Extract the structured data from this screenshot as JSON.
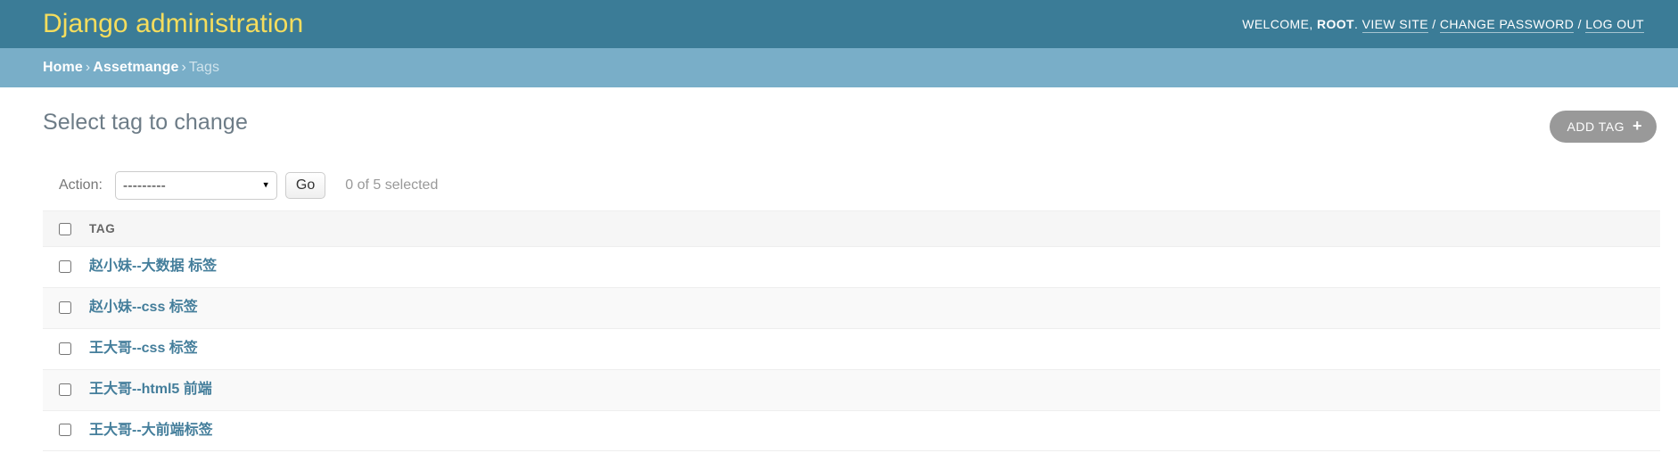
{
  "header": {
    "site_title": "Django administration",
    "welcome_prefix": "WELCOME,",
    "username": "ROOT",
    "welcome_suffix": ".",
    "links": {
      "view_site": "VIEW SITE",
      "change_password": "CHANGE PASSWORD",
      "log_out": "LOG OUT"
    },
    "separator": "/"
  },
  "breadcrumbs": {
    "home": "Home",
    "app": "Assetmange",
    "current": "Tags",
    "separator": "›"
  },
  "content": {
    "page_title": "Select tag to change",
    "add_button": {
      "label": "ADD TAG",
      "icon": "plus-icon",
      "icon_glyph": "+"
    }
  },
  "actions_bar": {
    "label": "Action:",
    "select_value": "---------",
    "select_options": [
      "---------"
    ],
    "go_button": "Go",
    "counter": "0 of 5 selected",
    "dropdown_icon": "▾"
  },
  "table": {
    "columns": [
      "TAG"
    ],
    "select_all_title": "Toggle all",
    "rows": [
      {
        "tag": "赵小妹--大数据 标签",
        "selected": false
      },
      {
        "tag": "赵小妹--css 标签",
        "selected": false
      },
      {
        "tag": "王大哥--css 标签",
        "selected": false
      },
      {
        "tag": "王大哥--html5 前端",
        "selected": false
      },
      {
        "tag": "王大哥--大前端标签",
        "selected": false
      }
    ]
  },
  "colors": {
    "header_bg": "#3b7c97",
    "header_title": "#f5dd5d",
    "breadcrumb_bg": "#79aec8",
    "link": "#447e9b",
    "page_title": "#6d7c87",
    "add_button_bg": "#999999",
    "row_alt_bg": "#f9f9f9",
    "table_head_bg": "#f6f6f6"
  }
}
